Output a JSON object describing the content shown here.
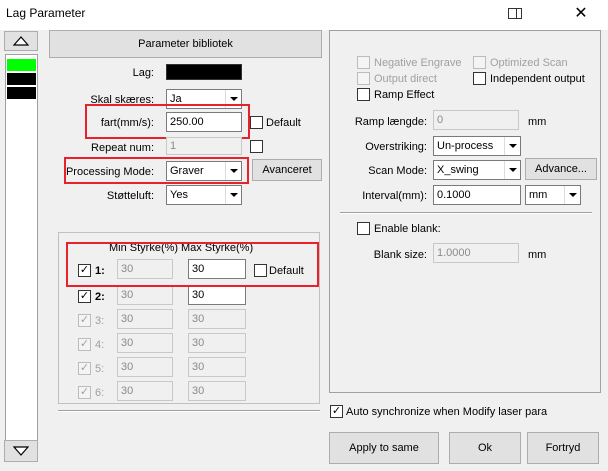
{
  "window": {
    "title": "Lag Parameter",
    "close_glyph": "✕"
  },
  "left_rail": {
    "colors": [
      "#00ff00",
      "#000000",
      "#000000"
    ]
  },
  "library_button": "Parameter bibliotek",
  "form": {
    "lag_label": "Lag:",
    "lag_color": "#000000",
    "skal_label": "Skal skæres:",
    "skal_value": "Ja",
    "fart_label": "fart(mm/s):",
    "fart_value": "250.00",
    "default_label": "Default",
    "repeat_label": "Repeat num:",
    "repeat_value": "1",
    "mode_label": "Processing Mode:",
    "mode_value": "Graver",
    "advanced_button": "Avanceret",
    "stotte_label": "Støtteluft:",
    "stotte_value": "Yes"
  },
  "power": {
    "min_header": "Min Styrke(%)",
    "max_header": "Max Styrke(%)",
    "default_label": "Default",
    "rows": [
      {
        "label": "1:",
        "min": "30",
        "max": "30",
        "check": "✓"
      },
      {
        "label": "2:",
        "min": "30",
        "max": "30",
        "check": "✓"
      },
      {
        "label": "3:",
        "min": "30",
        "max": "30",
        "check": "✓"
      },
      {
        "label": "4:",
        "min": "30",
        "max": "30",
        "check": "✓"
      },
      {
        "label": "5:",
        "min": "30",
        "max": "30",
        "check": "✓"
      },
      {
        "label": "6:",
        "min": "30",
        "max": "30",
        "check": "✓"
      }
    ]
  },
  "right": {
    "negative_engrave": "Negative Engrave",
    "optimized_scan": "Optimized Scan",
    "output_direct": "Output direct",
    "independent_output": "Independent output",
    "ramp_effect": "Ramp Effect",
    "ramp_length_label": "Ramp længde:",
    "ramp_length_value": "0",
    "unit_mm": "mm",
    "overstriking_label": "Overstriking:",
    "overstriking_value": "Un-process",
    "scan_mode_label": "Scan Mode:",
    "scan_mode_value": "X_swing",
    "advance_button": "Advance...",
    "interval_label": "Interval(mm):",
    "interval_value": "0.1000",
    "interval_unit": "mm",
    "enable_blank": "Enable blank:",
    "blank_size_label": "Blank size:",
    "blank_size_value": "1.0000"
  },
  "bottom": {
    "auto_sync": "Auto synchronize when Modify laser para",
    "apply_button": "Apply to same",
    "ok_button": "Ok",
    "cancel_button": "Fortryd",
    "check_glyph": "✓"
  }
}
